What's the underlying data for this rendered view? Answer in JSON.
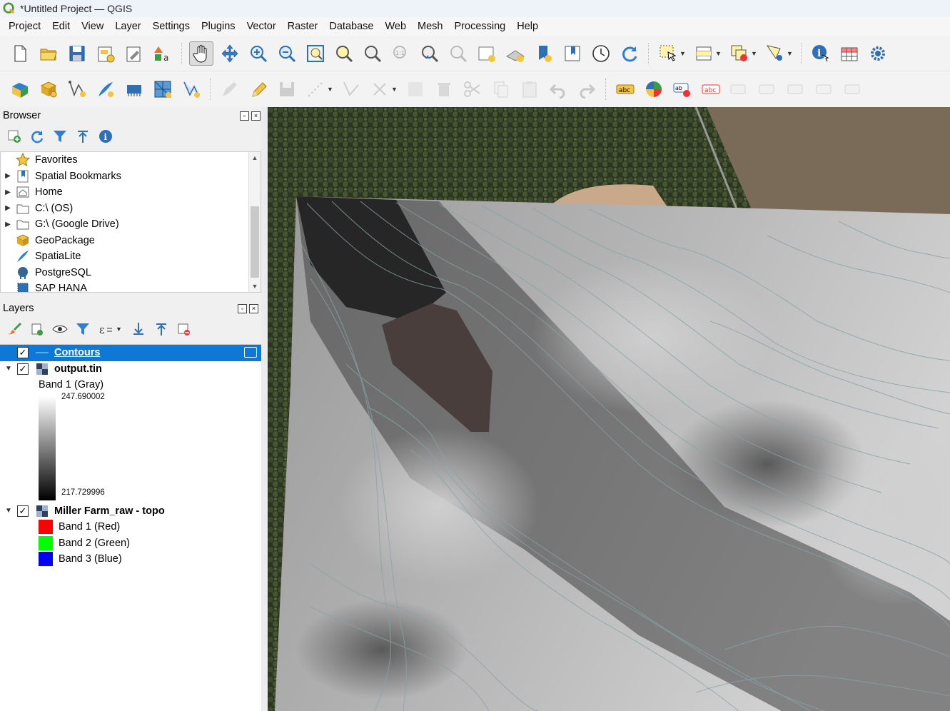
{
  "window": {
    "title": "*Untitled Project — QGIS"
  },
  "menu": [
    "Project",
    "Edit",
    "View",
    "Layer",
    "Settings",
    "Plugins",
    "Vector",
    "Raster",
    "Database",
    "Web",
    "Mesh",
    "Processing",
    "Help"
  ],
  "browser": {
    "title": "Browser",
    "items": [
      {
        "label": "Favorites",
        "icon": "star-icon",
        "expandable": false
      },
      {
        "label": "Spatial Bookmarks",
        "icon": "bookmark-icon",
        "expandable": true
      },
      {
        "label": "Home",
        "icon": "home-icon",
        "expandable": true
      },
      {
        "label": "C:\\ (OS)",
        "icon": "folder-icon",
        "expandable": true
      },
      {
        "label": "G:\\ (Google Drive)",
        "icon": "folder-icon",
        "expandable": true
      },
      {
        "label": "GeoPackage",
        "icon": "geopackage-icon",
        "expandable": false
      },
      {
        "label": "SpatiaLite",
        "icon": "spatialite-icon",
        "expandable": false
      },
      {
        "label": "PostgreSQL",
        "icon": "postgresql-icon",
        "expandable": false
      },
      {
        "label": "SAP HANA",
        "icon": "saphana-icon",
        "expandable": false
      }
    ]
  },
  "layers": {
    "title": "Layers",
    "contours": {
      "name": "Contours",
      "checked": true
    },
    "tin": {
      "name": "output.tin",
      "checked": true,
      "band": "Band 1 (Gray)",
      "max": "247.690002",
      "min": "217.729996"
    },
    "topo": {
      "name": "Miller Farm_raw - topo",
      "checked": true,
      "bands": [
        {
          "label": "Band 1 (Red)",
          "color": "#ff0000"
        },
        {
          "label": "Band 2 (Green)",
          "color": "#00ff00"
        },
        {
          "label": "Band 3 (Blue)",
          "color": "#0000ff"
        }
      ]
    }
  }
}
